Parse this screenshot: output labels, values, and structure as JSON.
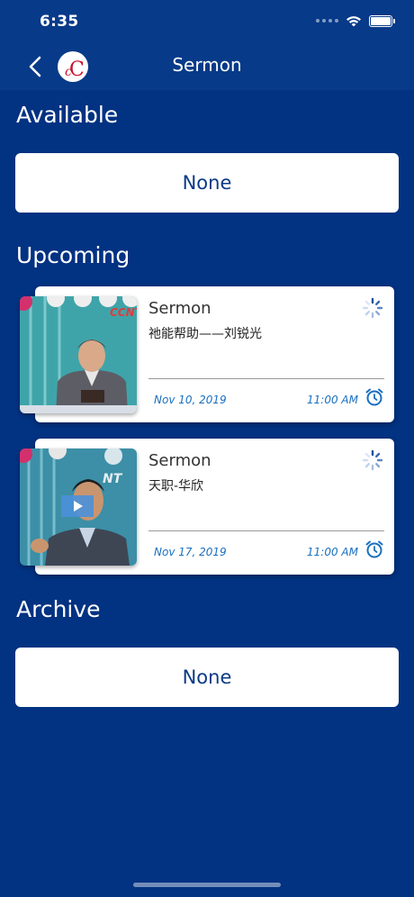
{
  "status_bar": {
    "time": "6:35"
  },
  "nav": {
    "title": "Sermon",
    "back_icon": "chevron-left-icon",
    "logo_text": "cC"
  },
  "sections": {
    "available": {
      "title": "Available",
      "empty_label": "None"
    },
    "upcoming": {
      "title": "Upcoming",
      "items": [
        {
          "title": "Sermon",
          "subtitle": "祂能帮助——刘锐光",
          "date": "Nov 10, 2019",
          "time": "11:00 AM"
        },
        {
          "title": "Sermon",
          "subtitle": "天职-华欣",
          "date": "Nov 17, 2019",
          "time": "11:00 AM"
        }
      ]
    },
    "archive": {
      "title": "Archive",
      "empty_label": "None"
    }
  },
  "colors": {
    "background": "#023282",
    "header": "#073a88",
    "accent": "#1a6fbf",
    "card": "#ffffff"
  }
}
